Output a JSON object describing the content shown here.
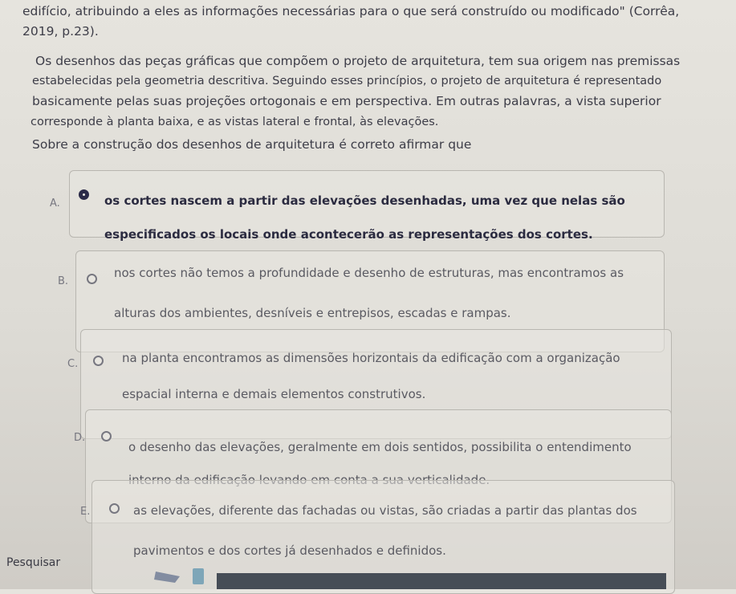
{
  "question": {
    "lines": [
      "edifício, atribuindo a eles as informações necessárias para o que será construído ou modificado\" (Corrêa,",
      "2019, p.23).",
      "Os desenhos das peças gráficas que compõem o projeto de arquitetura, tem sua origem nas premissas",
      "estabelecidas pela geometria descritiva. Seguindo esses princípios, o projeto de arquitetura é representado",
      "basicamente pelas suas projeções ortogonais e em perspectiva. Em outras palavras, a vista superior",
      "corresponde à planta baixa, e as vistas lateral e frontal, às elevações.",
      "Sobre a construção dos desenhos de arquitetura é correto afirmar que"
    ]
  },
  "options": [
    {
      "letter": "A.",
      "selected": true,
      "lines": [
        "os cortes nascem a partir das elevações desenhadas, uma vez que nelas são",
        "especificados os locais onde acontecerão as representações dos cortes."
      ]
    },
    {
      "letter": "B.",
      "selected": false,
      "lines": [
        "nos cortes não temos a profundidade e desenho de estruturas, mas encontramos as",
        "alturas dos ambientes, desníveis e entrepisos, escadas e rampas."
      ]
    },
    {
      "letter": "C.",
      "selected": false,
      "lines": [
        "na planta encontramos as dimensões horizontais da edificação com a organização",
        "espacial interna e demais elementos construtivos."
      ]
    },
    {
      "letter": "D.",
      "selected": false,
      "lines": [
        "o desenho das elevações, geralmente em dois sentidos, possibilita o entendimento",
        "interno da edificação levando em conta a sua verticalidade."
      ]
    },
    {
      "letter": "E.",
      "selected": false,
      "lines": [
        "as elevações, diferente das fachadas ou vistas, são criadas a partir das plantas dos",
        "pavimentos e dos cortes já desenhados e definidos."
      ]
    }
  ],
  "taskbar": {
    "search_label": "Pesquisar",
    "search_icon": "magnifier-icon"
  },
  "colors": {
    "selected_radio": "#2a2a48",
    "text": "#3d3d48",
    "border": "#b8b6b0"
  }
}
